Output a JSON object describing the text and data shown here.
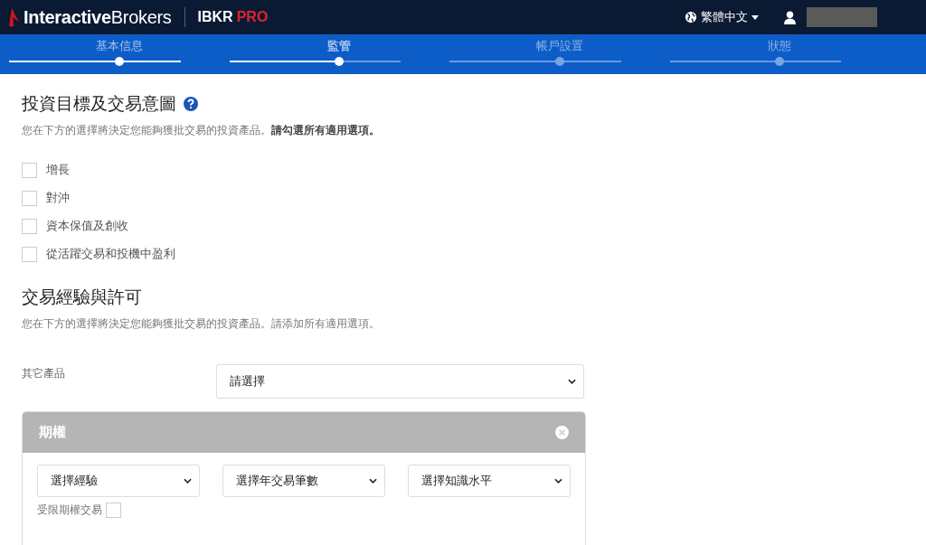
{
  "header": {
    "logo": "**Interactive**Brokers",
    "product": "IBKR",
    "product_tier": "PRO",
    "language": "繁體中文"
  },
  "steps": [
    {
      "label": "基本信息",
      "completed": true,
      "selected": false
    },
    {
      "label": "監管",
      "completed": true,
      "selected": true
    },
    {
      "label": "帳戶設置",
      "completed": false,
      "selected": false
    },
    {
      "label": "狀態",
      "completed": false,
      "selected": false
    }
  ],
  "objectives": {
    "title": "投資目標及交易意圖",
    "description": "您在下方的選擇將決定您能夠獲批交易的投資產品。**請勾選所有適用選項。**",
    "options": [
      {
        "label": "增長",
        "checked": false
      },
      {
        "label": "對沖",
        "checked": false
      },
      {
        "label": "資本保值及創收",
        "checked": false
      },
      {
        "label": "從活躍交易和投機中盈利",
        "checked": false
      }
    ]
  },
  "experience": {
    "title": "交易經驗與許可",
    "description": "您在下方的選擇將決定您能夠獲批交易的投資產品。請添加所有適用選項。",
    "other_products_label": "其它產品",
    "other_products_value": "請選擇",
    "panel": {
      "title": "期權",
      "selects": [
        "選擇經驗",
        "選擇年交易筆數",
        "選擇知識水平"
      ],
      "restricted_label": "受限期權交易",
      "restricted_checked": false
    }
  }
}
